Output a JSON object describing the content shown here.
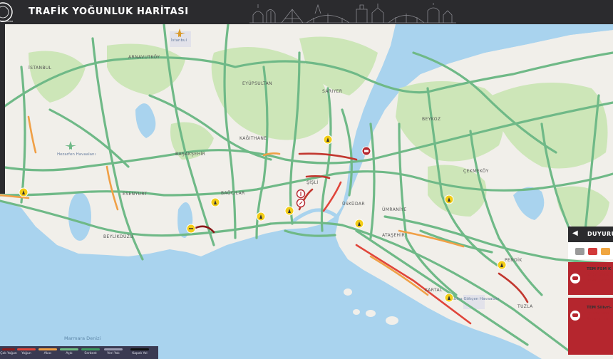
{
  "header": {
    "title": "TRAFİK YOĞUNLUK HARİTASI"
  },
  "map_labels": {
    "istanbul": "İSTANBUL",
    "arnavutkoy": "ARNAVUTKÖY",
    "eyupsultan": "EYÜPSULTAN",
    "sariyer": "SARIYER",
    "beykoz": "BEYKOZ",
    "kagithane": "KAĞITHANE",
    "basaksehir": "BAŞAKŞEHİR",
    "cekmekoy": "ÇEKMEKÖY",
    "esenyurt": "ESENYURT",
    "bagcilar": "BAĞCILAR",
    "sisli": "ŞİŞLİ",
    "uskudar": "ÜSKÜDAR",
    "umraniye": "ÜMRANİYE",
    "beylikduzu": "BEYLİKDÜZÜ",
    "atasehir": "ATAŞEHİR",
    "kartal": "KARTAL",
    "pendik": "PENDİK",
    "tuzla": "TUZLA",
    "istanbul_airport": "İstanbul",
    "hezarfen": "Hezarfen Havaalanı",
    "sabiha": "Sabiha Gökçen Havaalanı",
    "marmara": "Marmara Denizi"
  },
  "legend": [
    {
      "label": "Çok Yoğun",
      "color": "#8b1a1a"
    },
    {
      "label": "Yoğun",
      "color": "#e0453a"
    },
    {
      "label": "Akıcı",
      "color": "#f0a046"
    },
    {
      "label": "Açık",
      "color": "#6fbf83"
    },
    {
      "label": "Serbest",
      "color": "#3c9a5f"
    },
    {
      "label": "Veri Yok",
      "color": "#9b9bb0"
    },
    {
      "label": "Kapalı Yol",
      "color": "#111111"
    }
  ],
  "announcements": {
    "title": "DUYURU",
    "filter_colors": [
      "#9a9a9a",
      "#d23a3a",
      "#f0a640"
    ],
    "items": [
      {
        "line1": "TEM FSM K",
        "line2": "gelen trafik",
        "line3": "devam etm"
      },
      {
        "line1": "TEM Silivri-",
        "line2": "(yaralanma",
        "line3": "Kazaya mü"
      }
    ]
  },
  "colors": {
    "header_bg": "#2b2b2e",
    "land": "#f1efea",
    "water": "#a9d3ee",
    "forest": "#cde6b8",
    "road_free": "#6fb987",
    "alert_red": "#b5262e",
    "roadwork_yellow": "#f3cd17"
  }
}
